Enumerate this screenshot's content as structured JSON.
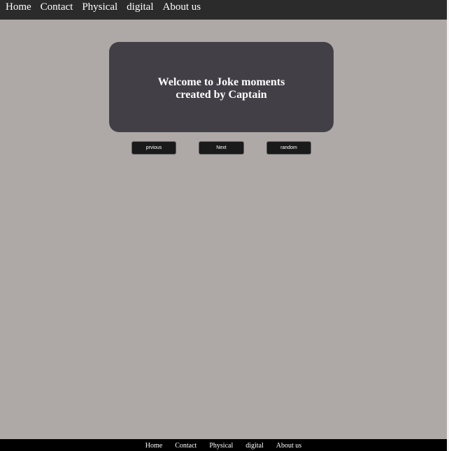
{
  "top_nav": {
    "items": [
      "Home",
      "Contact",
      "Physical",
      "digital",
      "About us"
    ]
  },
  "hero": {
    "line1": "Welcome to Joke moments",
    "line2": "created by Captain"
  },
  "buttons": {
    "previous": "prvious",
    "next": "Next",
    "random": "random"
  },
  "footer_nav": {
    "items": [
      "Home",
      "Contact",
      "Physical",
      "digital",
      "About us"
    ]
  },
  "colors": {
    "page_bg": "#aea8a7",
    "nav_bg": "#2b2b2b",
    "card_bg": "#423f46",
    "button_bg": "#1a1a1a",
    "footer_bg": "#000000"
  }
}
